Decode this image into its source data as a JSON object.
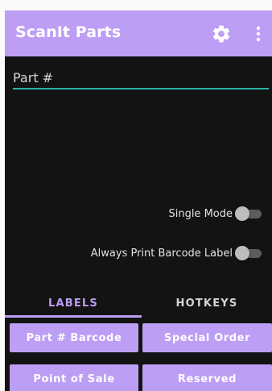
{
  "app_bar": {
    "title": "ScanIt Parts",
    "settings_icon": "gear-icon",
    "more_icon": "more-vert-icon"
  },
  "part_field": {
    "placeholder": "Part #",
    "value": ""
  },
  "toggles": [
    {
      "label": "Single Mode",
      "on": false
    },
    {
      "label": "Always Print Barcode Label",
      "on": false
    }
  ],
  "tabs": [
    {
      "label": "LABELS",
      "selected": true
    },
    {
      "label": "HOTKEYS",
      "selected": false
    }
  ],
  "label_buttons": [
    {
      "label": "Part # Barcode"
    },
    {
      "label": "Special Order"
    },
    {
      "label": "Point of Sale"
    },
    {
      "label": "Reserved"
    }
  ],
  "colors": {
    "accent": "#bc9ef4",
    "input_underline": "#27b4a4",
    "background": "#131313"
  }
}
